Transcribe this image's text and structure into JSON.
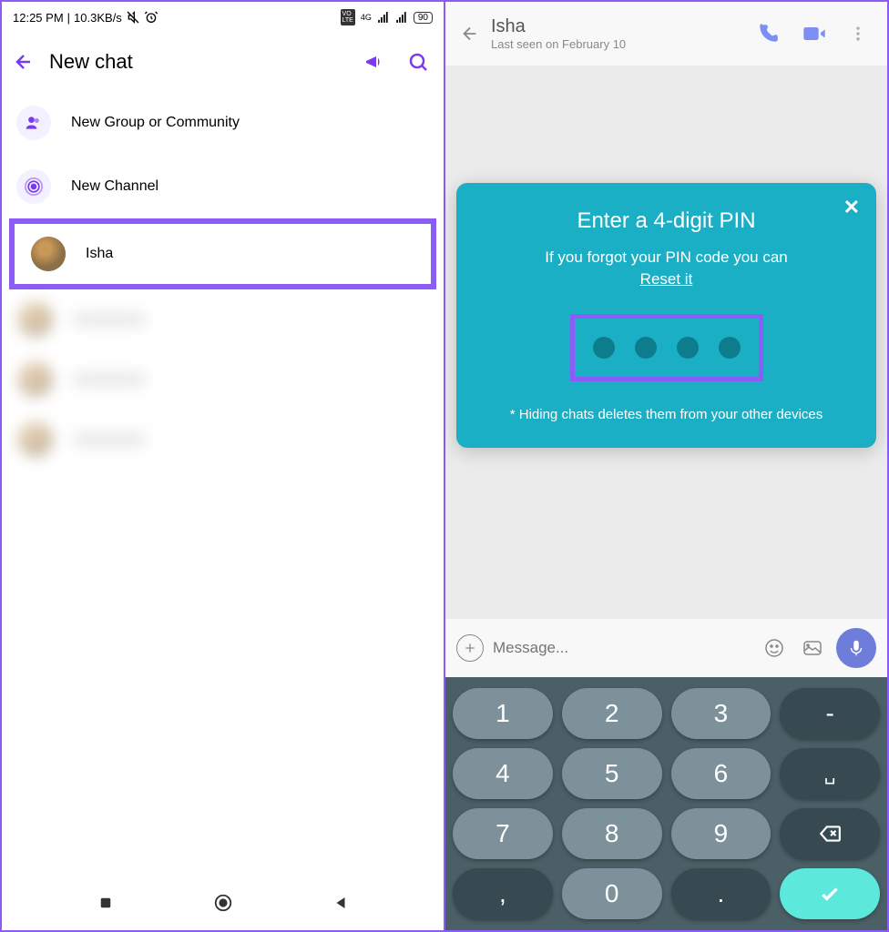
{
  "statusBar": {
    "time": "12:25 PM",
    "speed": "10.3KB/s",
    "battery": "90",
    "network": "4G"
  },
  "left": {
    "title": "New chat",
    "optNewGroup": "New Group or Community",
    "optNewChannel": "New Channel",
    "contact1": "Isha"
  },
  "right": {
    "chatName": "Isha",
    "lastSeen": "Last seen on February 10",
    "pin": {
      "title": "Enter a 4-digit PIN",
      "forgot": "If you forgot your PIN code you can",
      "reset": "Reset it",
      "note": "* Hiding chats deletes them from your other devices"
    },
    "msgPlaceholder": "Message...",
    "keys": {
      "k1": "1",
      "k2": "2",
      "k3": "3",
      "k4": "4",
      "k5": "5",
      "k6": "6",
      "k7": "7",
      "k8": "8",
      "k9": "9",
      "k0": "0",
      "dash": "-"
    }
  }
}
